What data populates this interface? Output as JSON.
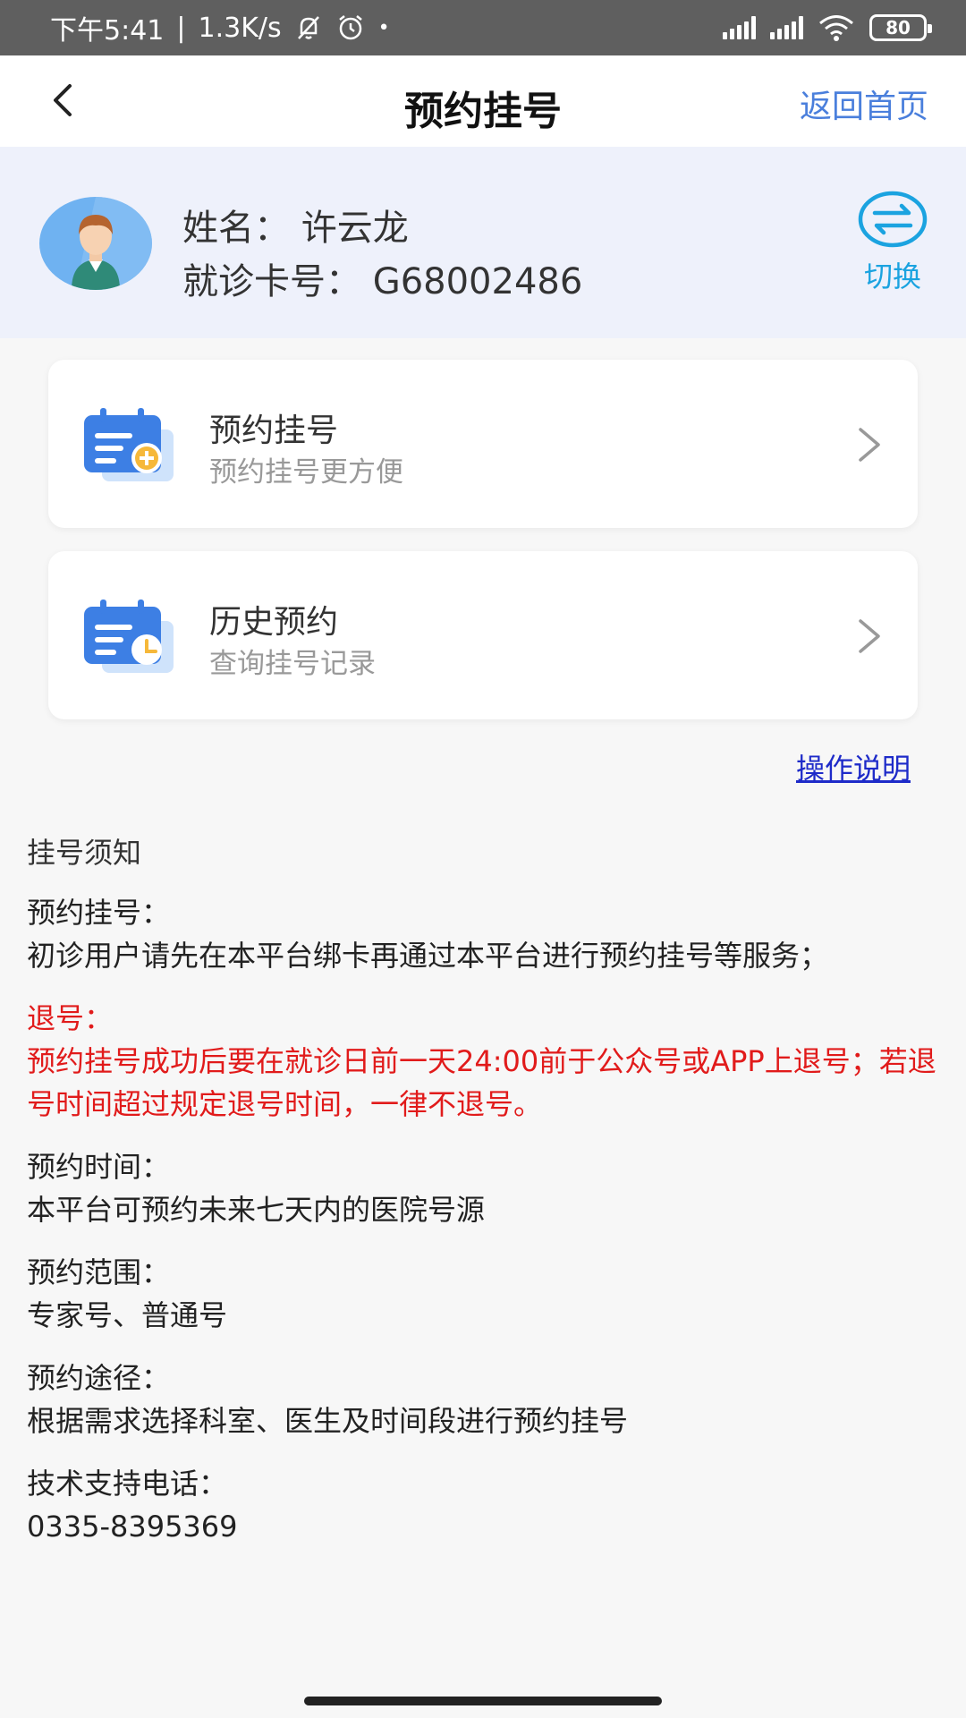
{
  "status_bar": {
    "time": "下午5:41",
    "net_speed": "1.3K/s",
    "battery": "80",
    "icons": [
      "bell-muted-icon",
      "alarm-icon",
      "signal-icon",
      "wifi-icon",
      "battery-icon"
    ]
  },
  "nav": {
    "title": "预约挂号",
    "home_link": "返回首页"
  },
  "patient": {
    "name": "姓名：  许云龙",
    "card": "就诊卡号：  G68002486",
    "switch_label": "切换"
  },
  "cards": [
    {
      "title": "预约挂号",
      "subtitle": "预约挂号更方便"
    },
    {
      "title": "历史预约",
      "subtitle": "查询挂号记录"
    }
  ],
  "help_link": "操作说明",
  "notice": {
    "heading": "挂号须知",
    "sections": [
      {
        "title": "预约挂号：",
        "body": "初诊用户请先在本平台绑卡再通过本平台进行预约挂号等服务；"
      },
      {
        "title": "退号：",
        "body": "预约挂号成功后要在就诊日前一天24:00前于公众号或APP上退号；若退号时间超过规定退号时间，一律不退号。"
      },
      {
        "title": "预约时间：",
        "body": "本平台可预约未来七天内的医院号源"
      },
      {
        "title": "预约范围：",
        "body": "专家号、普通号"
      },
      {
        "title": "预约途径：",
        "body": "根据需求选择科室、医生及时间段进行预约挂号"
      },
      {
        "title": "技术支持电话：",
        "body": "0335-8395369"
      }
    ]
  },
  "colors": {
    "accent_blue": "#4a7fdc",
    "switch_cyan": "#1ba3e0",
    "warning_red": "#e11b1b",
    "link_blue": "#1e2bc9"
  }
}
